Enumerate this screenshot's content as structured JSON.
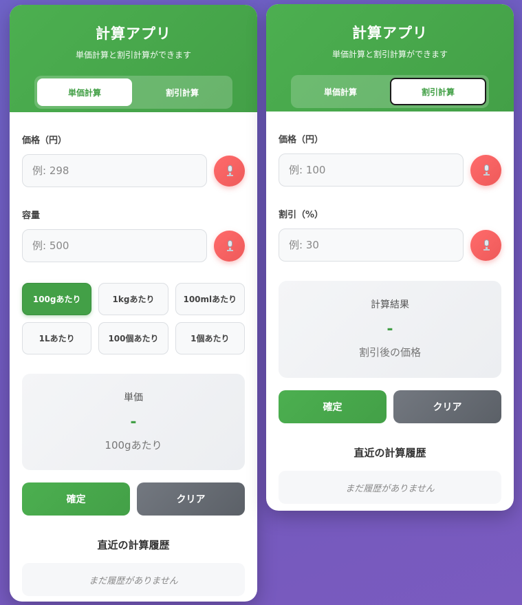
{
  "left": {
    "header": {
      "title": "計算アプリ",
      "subtitle": "単価計算と割引計算ができます"
    },
    "tabs": [
      {
        "label": "単価計算"
      },
      {
        "label": "割引計算"
      }
    ],
    "fields": [
      {
        "label": "価格（円）",
        "placeholder": "例: 298"
      },
      {
        "label": "容量",
        "placeholder": "例: 500"
      }
    ],
    "units": [
      {
        "label": "100gあたり"
      },
      {
        "label": "1kgあたり"
      },
      {
        "label": "100mlあたり"
      },
      {
        "label": "1Lあたり"
      },
      {
        "label": "100個あたり"
      },
      {
        "label": "1個あたり"
      }
    ],
    "selected_unit": "100gあたり",
    "result": {
      "label": "単価",
      "value": "-",
      "sub": "100gあたり"
    },
    "actions": {
      "confirm": "確定",
      "clear": "クリア"
    },
    "history": {
      "title": "直近の計算履歴",
      "empty": "まだ履歴がありません"
    }
  },
  "right": {
    "header": {
      "title": "計算アプリ",
      "subtitle": "単価計算と割引計算ができます"
    },
    "tabs": [
      {
        "label": "単価計算"
      },
      {
        "label": "割引計算"
      }
    ],
    "fields": [
      {
        "label": "価格（円）",
        "placeholder": "例: 100"
      },
      {
        "label": "割引（%）",
        "placeholder": "例: 30"
      }
    ],
    "result": {
      "label": "計算結果",
      "value": "-",
      "sub": "割引後の価格"
    },
    "actions": {
      "confirm": "確定",
      "clear": "クリア"
    },
    "history": {
      "title": "直近の計算履歴",
      "empty": "まだ履歴がありません"
    }
  },
  "icons": {
    "mic": "microphone-icon"
  },
  "colors": {
    "accent": "#43a047",
    "mic": "#ee5a5a",
    "clear": "#5b6067",
    "background": "#7158bd"
  }
}
